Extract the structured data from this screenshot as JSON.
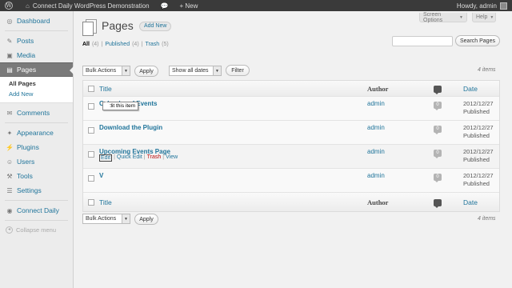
{
  "admin_bar": {
    "site_name": "Connect Daily WordPress Demonstration",
    "comments_count": "",
    "new_label": "+ New",
    "howdy": "Howdy, admin"
  },
  "sidebar": {
    "items": [
      {
        "label": "Dashboard",
        "icon": "dashboard-icon"
      },
      {
        "label": "Posts",
        "icon": "pin-icon"
      },
      {
        "label": "Media",
        "icon": "media-icon"
      },
      {
        "label": "Pages",
        "icon": "pages-icon"
      },
      {
        "label": "Comments",
        "icon": "comments-icon"
      },
      {
        "label": "Appearance",
        "icon": "appearance-icon"
      },
      {
        "label": "Plugins",
        "icon": "plugins-icon"
      },
      {
        "label": "Users",
        "icon": "users-icon"
      },
      {
        "label": "Tools",
        "icon": "tools-icon"
      },
      {
        "label": "Settings",
        "icon": "settings-icon"
      },
      {
        "label": "Connect Daily",
        "icon": "connect-daily-icon"
      }
    ],
    "submenu": [
      "All Pages",
      "Add New"
    ],
    "collapse": "Collapse menu"
  },
  "header": {
    "screen_options": "Screen Options",
    "help": "Help",
    "title": "Pages",
    "add_new": "Add New"
  },
  "filters": {
    "all": "All",
    "all_count": "(4)",
    "published": "Published",
    "published_count": "(4)",
    "trash": "Trash",
    "trash_count": "(5)",
    "sep": "|"
  },
  "search": {
    "button": "Search Pages"
  },
  "tablenav": {
    "bulk_actions": "Bulk Actions",
    "apply": "Apply",
    "dates": "Show all dates",
    "filter": "Filter",
    "items": "4 items"
  },
  "table": {
    "headers": {
      "title": "Title",
      "author": "Author",
      "date": "Date"
    },
    "rows": [
      {
        "title": "Calendar of Events",
        "author": "admin",
        "comments": "0",
        "date": "2012/12/27",
        "status": "Published"
      },
      {
        "title": "Download the Plugin",
        "author": "admin",
        "comments": "0",
        "date": "2012/12/27",
        "status": "Published"
      },
      {
        "title": "Upcoming Events Page",
        "author": "admin",
        "comments": "0",
        "date": "2012/12/27",
        "status": "Published"
      },
      {
        "title": "V",
        "author": "admin",
        "comments": "0",
        "date": "2012/12/27",
        "status": "Published"
      }
    ],
    "row_actions": {
      "edit": "Edit",
      "quick_edit": "Quick Edit",
      "trash": "Trash",
      "view": "View",
      "sep": "|"
    },
    "tooltip": "Edit this item"
  }
}
